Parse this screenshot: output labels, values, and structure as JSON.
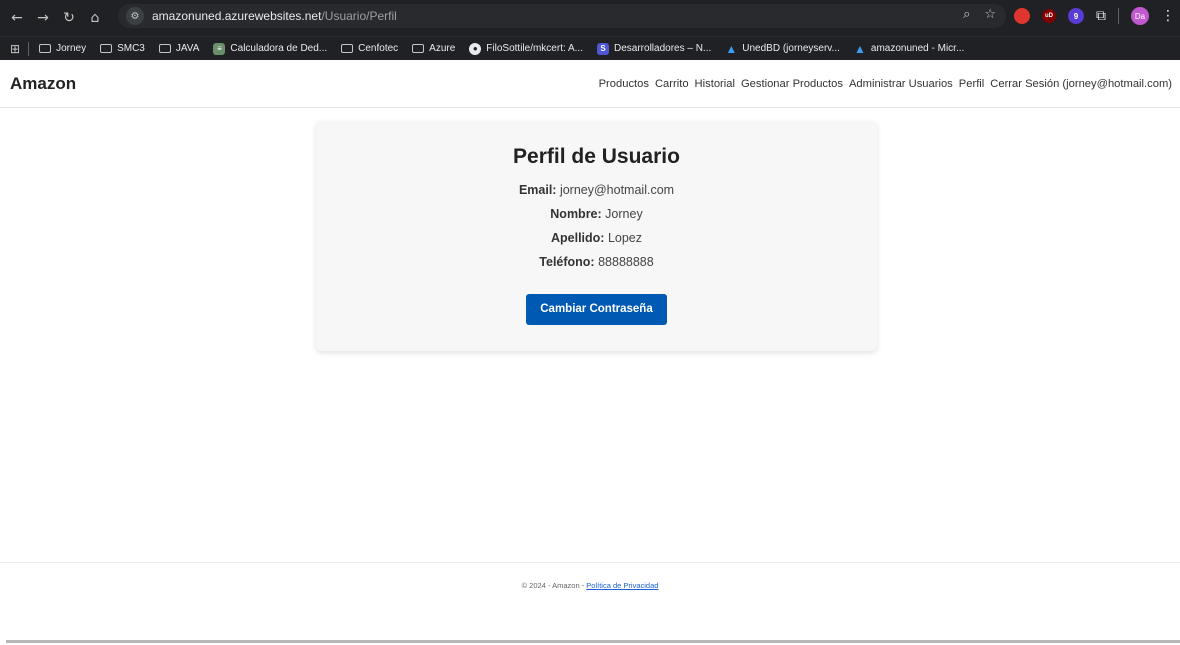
{
  "browser": {
    "url_host": "amazonuned.azurewebsites.net",
    "url_path": "/Usuario/Perfil",
    "avatar_initials": "Da",
    "ext_badge_count": "9",
    "bookmarks": [
      {
        "label": "Jorney",
        "icon": "folder-icon"
      },
      {
        "label": "SMC3",
        "icon": "folder-icon"
      },
      {
        "label": "JAVA",
        "icon": "folder-icon"
      },
      {
        "label": "Calculadora de Ded...",
        "icon": "calculator-icon"
      },
      {
        "label": "Cenfotec",
        "icon": "folder-icon"
      },
      {
        "label": "Azure",
        "icon": "folder-icon"
      },
      {
        "label": "FiloSottile/mkcert: A...",
        "icon": "github-icon"
      },
      {
        "label": "Desarrolladores – N...",
        "icon": "s-icon"
      },
      {
        "label": "UnedBD (jorneyserv...",
        "icon": "azure-icon"
      },
      {
        "label": "amazonuned - Micr...",
        "icon": "azure-icon"
      }
    ]
  },
  "header": {
    "brand": "Amazon",
    "nav": {
      "productos": "Productos",
      "carrito": "Carrito",
      "historial": "Historial",
      "gestionar": "Gestionar Productos",
      "administrar": "Administrar Usuarios",
      "perfil": "Perfil",
      "cerrar": "Cerrar Sesión (jorney@hotmail.com)"
    }
  },
  "profile": {
    "title": "Perfil de Usuario",
    "email_label": "Email:",
    "email_value": "jorney@hotmail.com",
    "nombre_label": "Nombre:",
    "nombre_value": "Jorney",
    "apellido_label": "Apellido:",
    "apellido_value": "Lopez",
    "telefono_label": "Teléfono:",
    "telefono_value": "88888888",
    "change_password_label": "Cambiar Contraseña"
  },
  "footer": {
    "copyright": "© 2024 - Amazon - ",
    "privacy_link": "Política de Privacidad"
  },
  "colors": {
    "primary_button": "#0059b3",
    "link": "#1a5fd6",
    "chrome_dark": "#202124"
  }
}
